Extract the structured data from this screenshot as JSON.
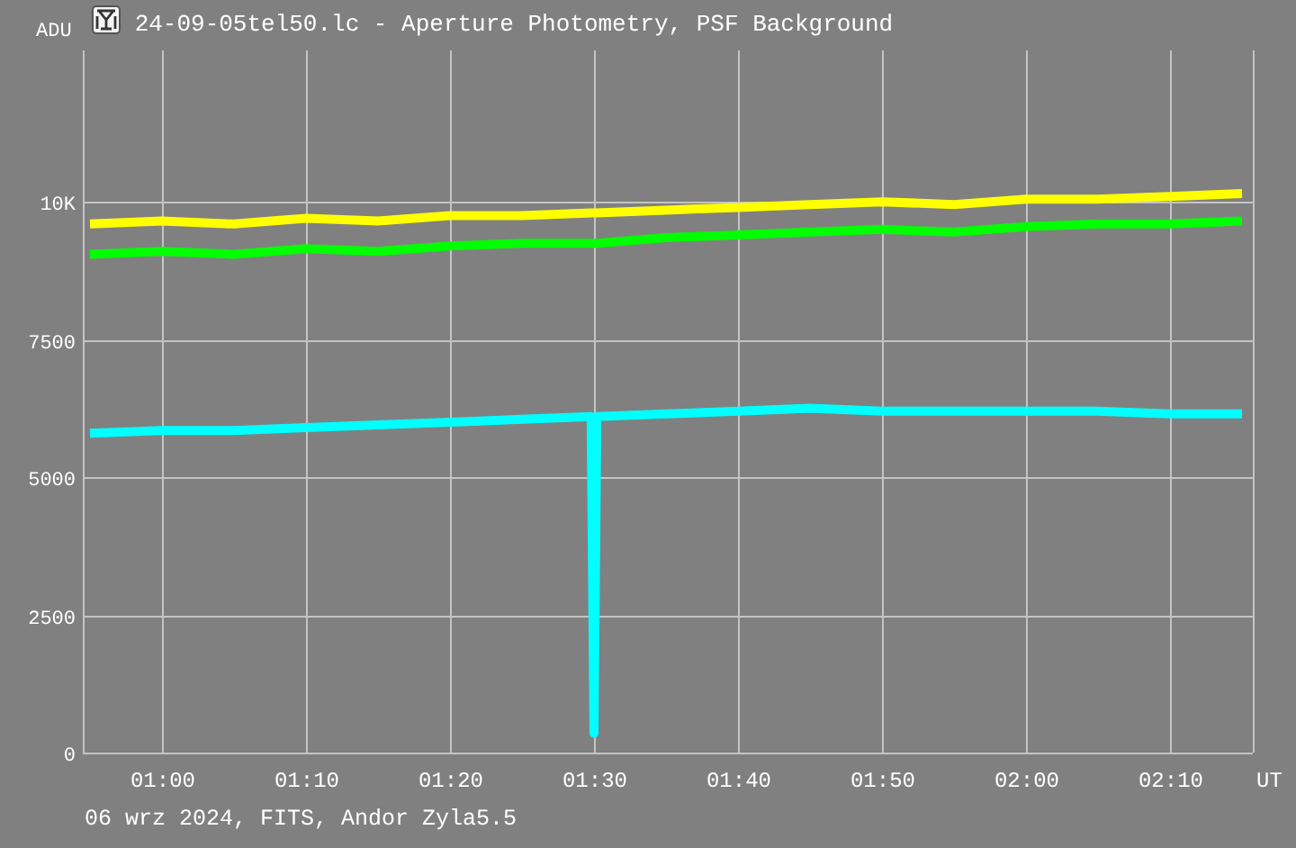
{
  "window": {
    "title": "24-09-05tel50.lc - Aperture Photometry, PSF Background"
  },
  "plot": {
    "chart_data": {
      "type": "line",
      "ylabel": "ADU",
      "xlabel": "UT",
      "x": [
        55,
        60,
        65,
        70,
        75,
        80,
        85,
        89.8,
        90,
        90.2,
        95,
        100,
        105,
        110,
        115,
        120,
        125,
        130,
        135
      ],
      "series": [
        {
          "color": "#ffff00",
          "values": [
            9600,
            9650,
            9600,
            9700,
            9650,
            9750,
            9750,
            9800,
            9800,
            9800,
            9850,
            9900,
            9950,
            10000,
            9950,
            10050,
            10050,
            10100,
            10150
          ]
        },
        {
          "color": "#00ff00",
          "values": [
            9050,
            9100,
            9050,
            9150,
            9100,
            9200,
            9250,
            9250,
            9250,
            9250,
            9350,
            9400,
            9450,
            9500,
            9450,
            9550,
            9600,
            9600,
            9650
          ]
        },
        {
          "color": "#00ffff",
          "values": [
            5800,
            5850,
            5850,
            5900,
            5950,
            6000,
            6050,
            6100,
            350,
            6100,
            6150,
            6200,
            6250,
            6200,
            6200,
            6200,
            6200,
            6150,
            6150
          ]
        }
      ],
      "xlim": [
        54.5,
        135.75
      ],
      "ylim": [
        0,
        12750
      ],
      "xticks": [
        {
          "value": 60,
          "label": "01:00"
        },
        {
          "value": 70,
          "label": "01:10"
        },
        {
          "value": 80,
          "label": "01:20"
        },
        {
          "value": 90,
          "label": "01:30"
        },
        {
          "value": 100,
          "label": "01:40"
        },
        {
          "value": 110,
          "label": "01:50"
        },
        {
          "value": 120,
          "label": "02:00"
        },
        {
          "value": 130,
          "label": "02:10"
        }
      ],
      "yticks": [
        0,
        2500,
        5000,
        7500,
        {
          "value": 10000,
          "label": "10K"
        }
      ],
      "grid": true
    }
  },
  "status_bar": {
    "text": "06 wrz 2024, FITS, Andor Zyla5.5"
  }
}
